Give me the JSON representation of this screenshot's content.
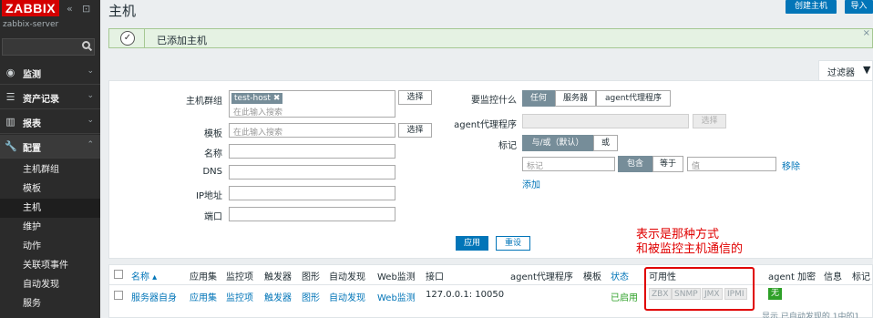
{
  "sidebar": {
    "logo": "ZABBIX",
    "collapse_icon": "«",
    "kiosk_icon": "⊡",
    "server_name": "zabbix-server",
    "menus": [
      {
        "label": "监测",
        "icon": "eye-icon",
        "glyph": "◉",
        "chevron": "⌄"
      },
      {
        "label": "资产记录",
        "icon": "list-icon",
        "glyph": "☰",
        "chevron": "⌄"
      },
      {
        "label": "报表",
        "icon": "chart-icon",
        "glyph": "▥",
        "chevron": "⌄"
      },
      {
        "label": "配置",
        "icon": "wrench-icon",
        "glyph": "🔧",
        "chevron": "⌃"
      }
    ],
    "submenu": [
      "主机群组",
      "模板",
      "主机",
      "维护",
      "动作",
      "关联项事件",
      "自动发现",
      "服务"
    ]
  },
  "header": {
    "title": "主机",
    "create_button": "创建主机",
    "import_button": "导入"
  },
  "message": {
    "text": "已添加主机",
    "close": "×",
    "check": "✓"
  },
  "filter_tab": {
    "label": "过滤器",
    "icon": "filter-icon",
    "glyph": "▼"
  },
  "filter": {
    "host_group_label": "主机群组",
    "host_group_tag": "test-host",
    "tag_remove": "✖",
    "placeholder": "在此输入搜索",
    "select_button": "选择",
    "template_label": "模板",
    "name_label": "名称",
    "dns_label": "DNS",
    "ip_label": "IP地址",
    "port_label": "端口",
    "monitored_by_label": "要监控什么",
    "monitored_by_options": [
      "任何",
      "服务器",
      "agent代理程序"
    ],
    "proxy_label": "agent代理程序",
    "tags_label": "标记",
    "tags_op_options": [
      "与/或（默认）",
      "或"
    ],
    "tag_placeholder": "标记",
    "tag_match_options": [
      "包含",
      "等于"
    ],
    "value_placeholder": "值",
    "remove_link": "移除",
    "add_link": "添加",
    "apply_button": "应用",
    "reset_button": "重设"
  },
  "annotation": {
    "line1": "表示是那种方式",
    "line2": "和被监控主机通信的"
  },
  "table": {
    "headers": {
      "name": "名称 ▴",
      "applications": "应用集",
      "items": "监控项",
      "triggers": "触发器",
      "graphs": "图形",
      "discovery": "自动发现",
      "web": "Web监测",
      "interface": "接口",
      "proxy": "agent代理程序",
      "templates": "模板",
      "status": "状态",
      "availability": "可用性",
      "encryption": "agent 加密",
      "info": "信息",
      "tags": "标记"
    },
    "row": {
      "name": "服务器自身",
      "applications": "应用集",
      "items": "监控项",
      "triggers": "触发器",
      "graphs": "图形",
      "discovery": "自动发现",
      "web": "Web监测",
      "interface": "127.0.0.1: 10050",
      "status": "已启用",
      "availability": [
        "ZBX",
        "SNMP",
        "JMX",
        "IPMI"
      ],
      "encryption": "无"
    },
    "footer": "显示 已自动发现的 1中的1"
  },
  "colors": {
    "accent": "#0275b8",
    "sidebar": "#2b2b2b",
    "logo": "#d40000",
    "enabled": "#2ea028",
    "annotation": "#e00000"
  }
}
